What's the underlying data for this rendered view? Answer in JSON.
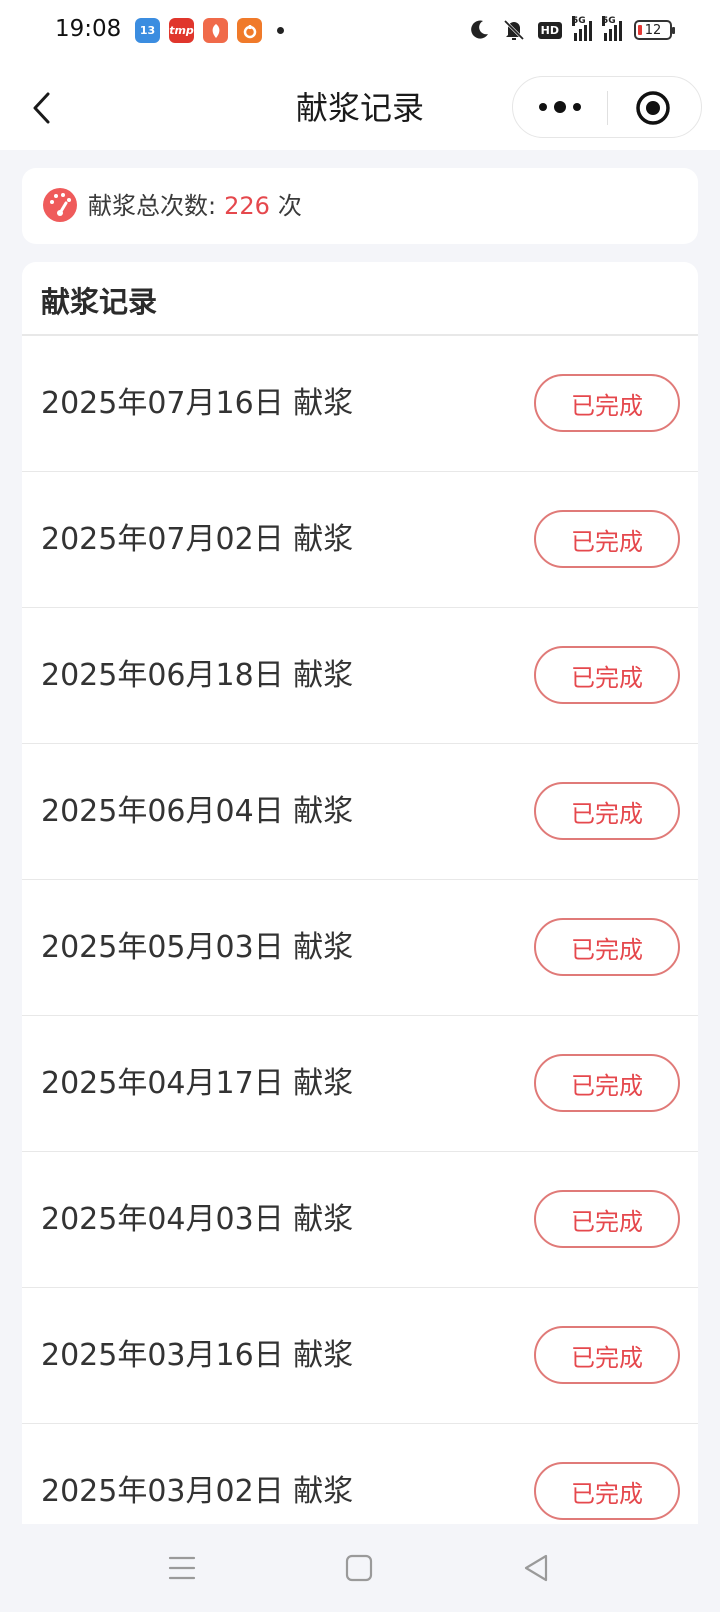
{
  "status_bar": {
    "time": "19:08",
    "app_icons": [
      {
        "name": "app-13-icon",
        "label": "13",
        "color": "#3b8de0"
      },
      {
        "name": "app-tmall-icon",
        "label": "tmp",
        "color": "#e0362c"
      },
      {
        "name": "app-red-icon",
        "label": "",
        "color": "#f06a4a"
      },
      {
        "name": "app-orange-icon",
        "label": "",
        "color": "#f07a2a"
      }
    ],
    "battery": "12",
    "network": [
      "5G",
      "5G"
    ],
    "hd_label": "HD"
  },
  "nav": {
    "title": "献浆记录"
  },
  "summary": {
    "label": "献浆总次数:",
    "count": "226",
    "unit": "次",
    "accent_color": "#e5484d"
  },
  "records": {
    "section_title": "献浆记录",
    "items": [
      {
        "date": "2025年07月16日 献浆",
        "status": "已完成"
      },
      {
        "date": "2025年07月02日 献浆",
        "status": "已完成"
      },
      {
        "date": "2025年06月18日 献浆",
        "status": "已完成"
      },
      {
        "date": "2025年06月04日 献浆",
        "status": "已完成"
      },
      {
        "date": "2025年05月03日 献浆",
        "status": "已完成"
      },
      {
        "date": "2025年04月17日 献浆",
        "status": "已完成"
      },
      {
        "date": "2025年04月03日 献浆",
        "status": "已完成"
      },
      {
        "date": "2025年03月16日 献浆",
        "status": "已完成"
      },
      {
        "date": "2025年03月02日 献浆",
        "status": "已完成"
      }
    ]
  }
}
